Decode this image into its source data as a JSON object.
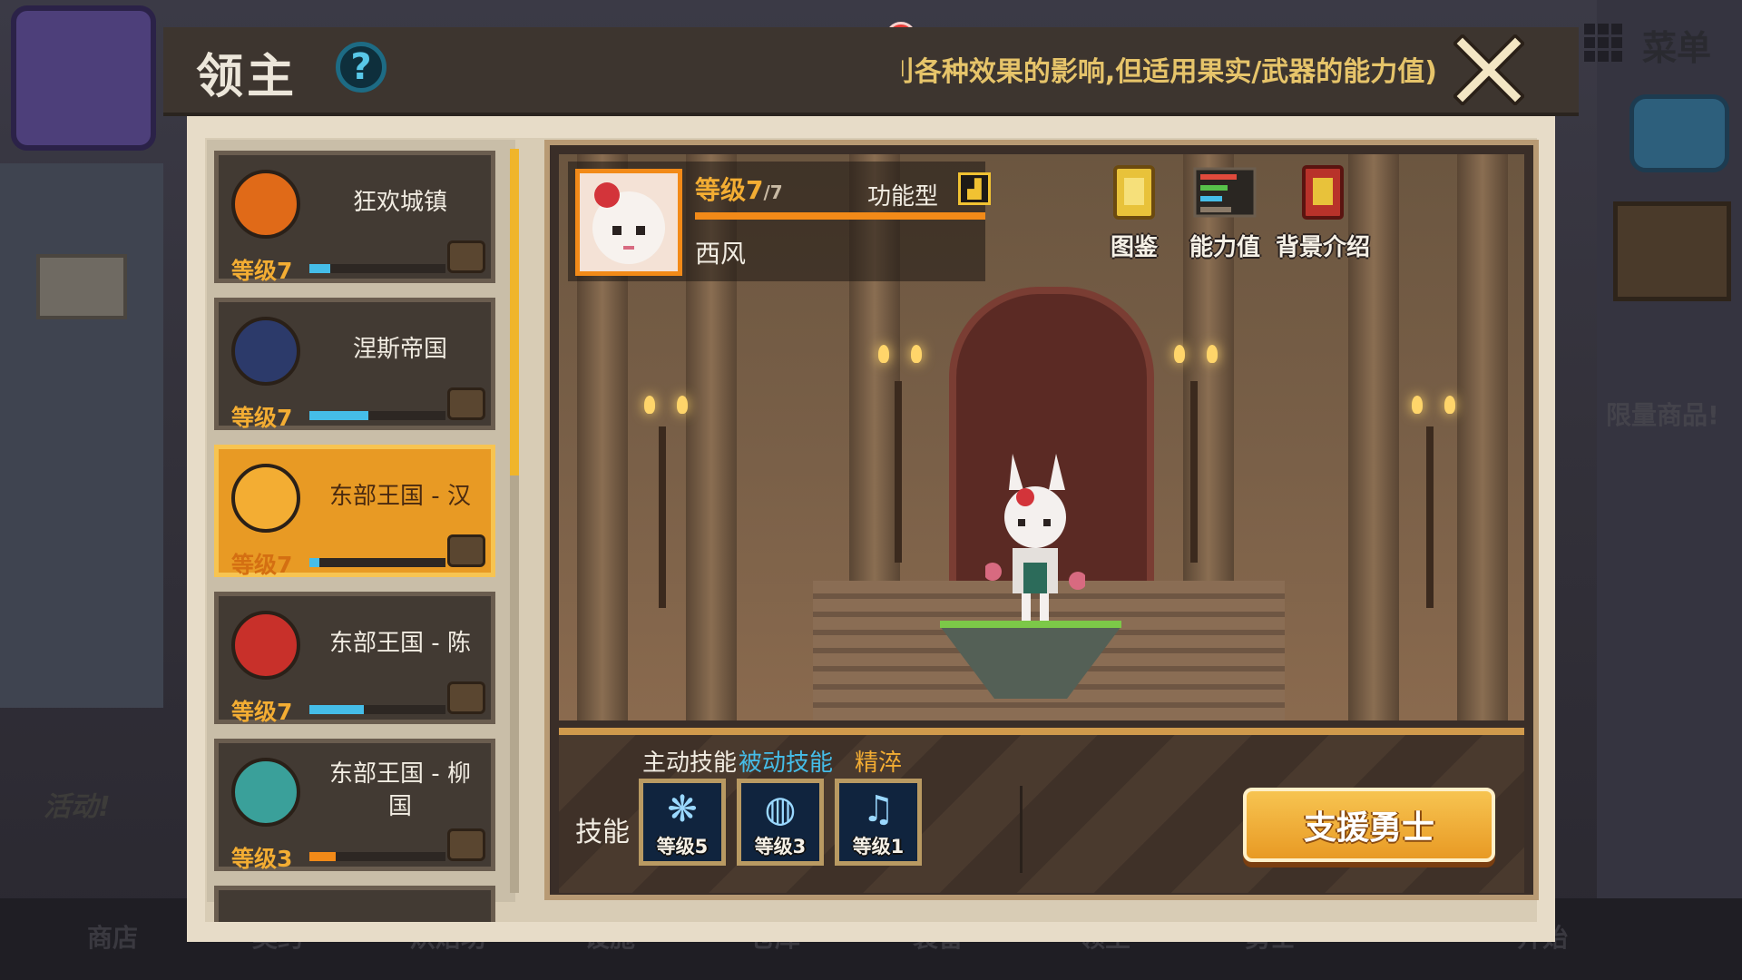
{
  "modal": {
    "title": "领主",
    "help_icon": "question-icon",
    "marquee_text": "刂各种效果的影响,但适用果实/武器的能力值)",
    "close_icon": "close-x-icon"
  },
  "background": {
    "menu_label": "菜单",
    "limited_label": "限量商品!",
    "activity_label": "活动!",
    "nav": [
      "商店",
      "契约",
      "烘焙坊",
      "设施",
      "仓库",
      "装备",
      "领主",
      "勇士",
      "开始"
    ]
  },
  "kingdoms": [
    {
      "name": "狂欢城镇",
      "level": "等级7",
      "progress": 0.15,
      "bar_color": "#45bde8",
      "icon": "pumpkin-crown-icon",
      "selected": false
    },
    {
      "name": "涅斯帝国",
      "level": "等级7",
      "progress": 0.43,
      "bar_color": "#45bde8",
      "icon": "eagle-shield-icon",
      "selected": false
    },
    {
      "name": "东部王国 - 汉",
      "level": "等级7",
      "progress": 0.07,
      "bar_color": "#45bde8",
      "icon": "taegeuk-icon",
      "selected": true
    },
    {
      "name": "东部王国 - 陈",
      "level": "等级7",
      "progress": 0.4,
      "bar_color": "#45bde8",
      "icon": "chinese-emblem-icon",
      "selected": false
    },
    {
      "name": "东部王国 - 柳国",
      "level": "等级3",
      "progress": 0.19,
      "bar_color": "#f28a18",
      "icon": "flower-wreath-icon",
      "selected": false
    }
  ],
  "hero": {
    "level": "等级7",
    "level_max": "/7",
    "type": "功能型",
    "type_icon": "boot-icon",
    "name": "西风"
  },
  "side_buttons": [
    {
      "label": "图鉴",
      "icon": "book-icon"
    },
    {
      "label": "能力值",
      "icon": "stats-icon"
    },
    {
      "label": "背景介绍",
      "icon": "scroll-icon"
    }
  ],
  "skills": {
    "label": "技能",
    "tabs": [
      "主动技能",
      "被动技能",
      "精淬"
    ],
    "slots": [
      {
        "level": "等级5",
        "icon": "rabbit-spirit-icon"
      },
      {
        "level": "等级3",
        "icon": "drum-icon"
      },
      {
        "level": "等级1",
        "icon": "horn-icon"
      }
    ],
    "support_button": "支援勇士"
  },
  "colors": {
    "accent_orange": "#f28a18",
    "accent_blue": "#45bde8",
    "selected_card": "#e89a24"
  }
}
